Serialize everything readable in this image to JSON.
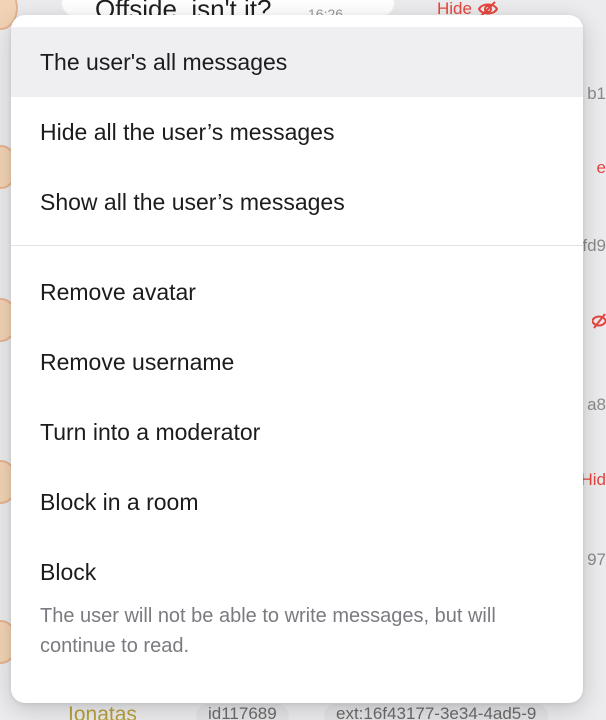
{
  "background": {
    "message_text": "Offside, isn't it?",
    "message_time": "16:26",
    "hide_label": "Hide",
    "right_fragments": [
      "b1",
      "e",
      "fd9",
      "",
      "a8",
      "Hid",
      "97"
    ],
    "bottom_name": "Ionatas",
    "bottom_id": "id117689",
    "bottom_ext": "ext:16f43177-3e34-4ad5-9"
  },
  "menu": {
    "items": [
      {
        "label": "The user's all messages"
      },
      {
        "label": "Hide all the user’s messages"
      },
      {
        "label": "Show all the user’s messages"
      },
      {
        "label": "Remove avatar"
      },
      {
        "label": "Remove username"
      },
      {
        "label": "Turn into a moderator"
      },
      {
        "label": "Block in a room"
      }
    ],
    "block": {
      "label": "Block",
      "description": "The user will not be able to write messages, but will continue to read."
    }
  },
  "colors": {
    "accent_red": "#e5463e",
    "menu_text": "#1c1c1e",
    "muted_text": "#7a7a80"
  }
}
